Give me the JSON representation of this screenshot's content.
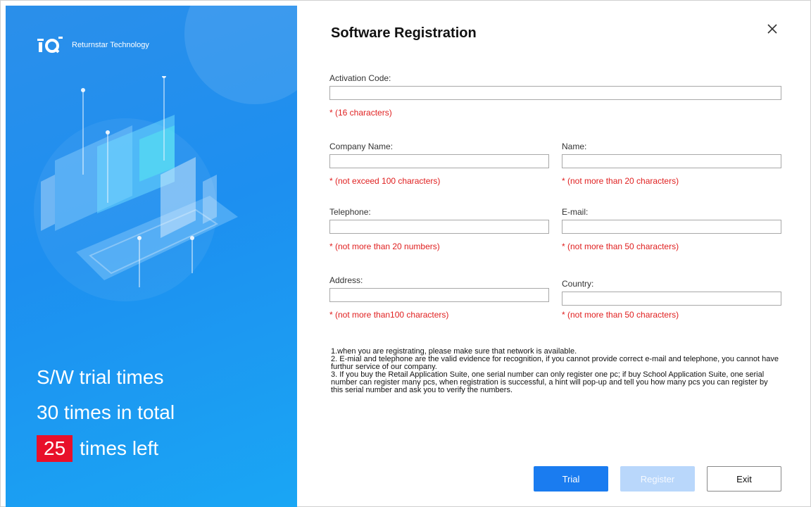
{
  "brand": {
    "name": "Returnstar Technology",
    "logo_text": "IQ"
  },
  "trial": {
    "line1": "S/W trial times",
    "line2": "30 times in total",
    "count": "25",
    "left_label": "times left"
  },
  "dialog": {
    "title": "Software Registration",
    "close_icon": "close-icon"
  },
  "fields": {
    "activation_code": {
      "label": "Activation Code:",
      "value": "",
      "hint": "* (16 characters)"
    },
    "company_name": {
      "label": "Company Name:",
      "value": "",
      "hint": "* (not exceed 100 characters)"
    },
    "name": {
      "label": "Name:",
      "value": "",
      "hint": "* (not more than 20 characters)"
    },
    "telephone": {
      "label": "Telephone:",
      "value": "",
      "hint": "* (not more than 20 numbers)"
    },
    "email": {
      "label": "E-mail:",
      "value": "",
      "hint": "* (not more than 50 characters)"
    },
    "address": {
      "label": "Address:",
      "value": "",
      "hint": "* (not more than100 characters)"
    },
    "country": {
      "label": "Country:",
      "value": "",
      "hint": "* (not more than 50 characters)"
    }
  },
  "notes": [
    "1.when you are registrating, please make sure that network is available.",
    "2. E-mial and telephone are the valid evidence for recognition, if you cannot provide correct e-mail and telephone, you cannot have furthur service of our company.",
    "3. If you buy the Retail Application Suite, one serial number can only register one pc; if buy School Application Suite, one serial number can register many pcs, when registration is successful, a hint will pop-up and tell you how many pcs you can register by this serial number and ask you to verify the numbers."
  ],
  "buttons": {
    "trial": "Trial",
    "register": "Register",
    "exit": "Exit"
  },
  "colors": {
    "accent": "#1a7cf0",
    "hint": "#e02020",
    "badge": "#e8102a",
    "panel": "#1d8ff0"
  }
}
